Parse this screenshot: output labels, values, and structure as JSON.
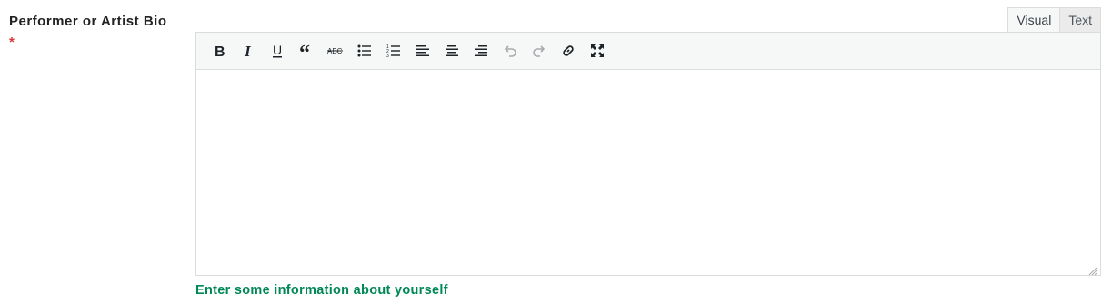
{
  "field": {
    "label": "Performer or Artist Bio",
    "required_mark": "*",
    "help_text": "Enter some information about yourself"
  },
  "editor": {
    "tabs": [
      {
        "label": "Visual",
        "active": true
      },
      {
        "label": "Text",
        "active": false
      }
    ],
    "content": "",
    "toolbar": [
      {
        "name": "bold",
        "icon": "bold-icon",
        "enabled": true
      },
      {
        "name": "italic",
        "icon": "italic-icon",
        "enabled": true
      },
      {
        "name": "underline",
        "icon": "underline-icon",
        "enabled": true
      },
      {
        "name": "blockquote",
        "icon": "blockquote-icon",
        "enabled": true
      },
      {
        "name": "strikethrough",
        "icon": "strikethrough-icon",
        "enabled": true
      },
      {
        "name": "bulleted-list",
        "icon": "bulleted-list-icon",
        "enabled": true
      },
      {
        "name": "numbered-list",
        "icon": "numbered-list-icon",
        "enabled": true
      },
      {
        "name": "align-left",
        "icon": "align-left-icon",
        "enabled": true
      },
      {
        "name": "align-center",
        "icon": "align-center-icon",
        "enabled": true
      },
      {
        "name": "align-right",
        "icon": "align-right-icon",
        "enabled": true
      },
      {
        "name": "undo",
        "icon": "undo-icon",
        "enabled": false
      },
      {
        "name": "redo",
        "icon": "redo-icon",
        "enabled": false
      },
      {
        "name": "insert-link",
        "icon": "link-icon",
        "enabled": true
      },
      {
        "name": "fullscreen",
        "icon": "fullscreen-icon",
        "enabled": true
      }
    ]
  },
  "colors": {
    "required": "#d63638",
    "help_text": "#008756",
    "toolbar_bg": "#f6f7f7",
    "border": "#dcdcde"
  }
}
